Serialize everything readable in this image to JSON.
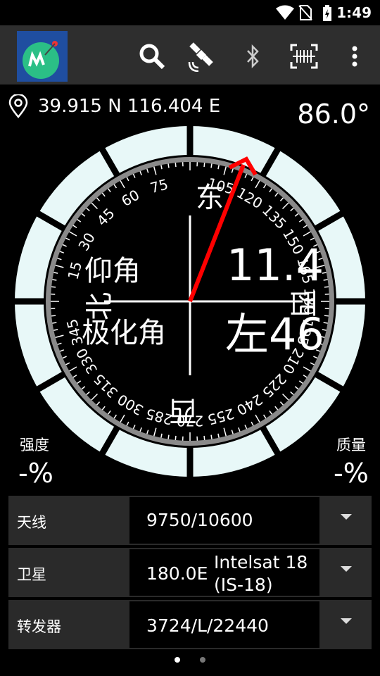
{
  "status_bar": {
    "time": "1:49"
  },
  "toolbar": {
    "app_logo": "app-logo",
    "icons": [
      "search-icon",
      "satellite-icon",
      "bluetooth-icon",
      "barcode-scanner-icon",
      "more-vert-icon"
    ]
  },
  "location": {
    "coords": "39.915 N 116.404 E"
  },
  "azimuth": "86.0°",
  "compass": {
    "north": "北",
    "east": "东",
    "south": "西",
    "west": "西",
    "label_elevation": "仰角",
    "label_polarization": "极化角",
    "elevation_value": "11.4",
    "polarization_value": "左46",
    "ticks_outer": [
      "15",
      "30",
      "45",
      "60",
      "75",
      "105",
      "120",
      "135",
      "150",
      "165",
      "180",
      "195",
      "210",
      "225",
      "240",
      "255",
      "270",
      "285",
      "300",
      "315",
      "330",
      "345"
    ]
  },
  "signal": {
    "strength_label": "强度",
    "strength_value": "-%",
    "quality_label": "质量",
    "quality_value": "-%"
  },
  "rows": [
    {
      "label": "天线",
      "value": "9750/10600"
    },
    {
      "label": "卫星",
      "value": "180.0E",
      "name_line1": "Intelsat 18",
      "name_line2": "(IS-18)"
    },
    {
      "label": "转发器",
      "value": "3724/L/22440"
    }
  ],
  "pager": {
    "pages": 2,
    "current": 1
  },
  "colors": {
    "needle": "#ff0000",
    "ring": "#e8f8f8",
    "toolbar": "#2e2e2e",
    "row_bg": "#2a2a2a"
  }
}
